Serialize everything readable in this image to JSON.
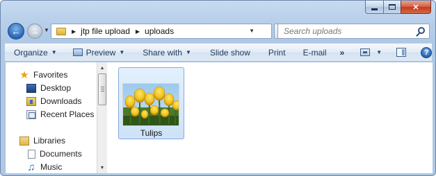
{
  "window": {
    "caption_buttons": {
      "minimize": "minimize-icon",
      "maximize": "maximize-icon",
      "close": "✕"
    }
  },
  "navigation": {
    "back_icon": "arrow-left-icon",
    "forward_icon": "arrow-right-icon",
    "breadcrumb": [
      "jtp file upload",
      "uploads"
    ],
    "search_placeholder": "Search uploads"
  },
  "toolbar": {
    "organize": "Organize",
    "preview": "Preview",
    "share_with": "Share with",
    "slide_show": "Slide show",
    "print": "Print",
    "email": "E-mail",
    "more": "»"
  },
  "nav_pane": {
    "favorites": "Favorites",
    "desktop": "Desktop",
    "downloads": "Downloads",
    "recent_places": "Recent Places",
    "libraries": "Libraries",
    "documents": "Documents",
    "music": "Music"
  },
  "files": [
    {
      "name": "Tulips",
      "thumbnail": "yellow-tulips-photo"
    }
  ],
  "colors": {
    "frame": "#b8cfea",
    "selection": "#cde2f8",
    "tulip_yellow": "#f2c21a"
  }
}
